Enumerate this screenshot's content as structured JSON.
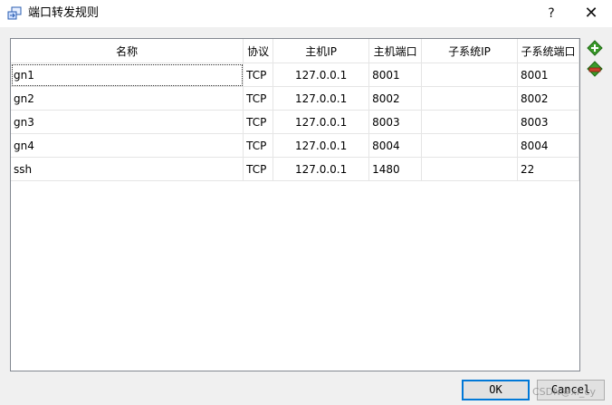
{
  "window": {
    "title": "端口转发规则",
    "help_label": "?",
    "close_label": "✕"
  },
  "table": {
    "columns": [
      "名称",
      "协议",
      "主机IP",
      "主机端口",
      "子系统IP",
      "子系统端口"
    ],
    "rows": [
      {
        "name": "gn1",
        "protocol": "TCP",
        "host_ip": "127.0.0.1",
        "host_port": "8001",
        "guest_ip": "",
        "guest_port": "8001"
      },
      {
        "name": "gn2",
        "protocol": "TCP",
        "host_ip": "127.0.0.1",
        "host_port": "8002",
        "guest_ip": "",
        "guest_port": "8002"
      },
      {
        "name": "gn3",
        "protocol": "TCP",
        "host_ip": "127.0.0.1",
        "host_port": "8003",
        "guest_ip": "",
        "guest_port": "8003"
      },
      {
        "name": "gn4",
        "protocol": "TCP",
        "host_ip": "127.0.0.1",
        "host_port": "8004",
        "guest_ip": "",
        "guest_port": "8004"
      },
      {
        "name": "ssh",
        "protocol": "TCP",
        "host_ip": "127.0.0.1",
        "host_port": "1480",
        "guest_ip": "",
        "guest_port": "22"
      }
    ]
  },
  "side_buttons": {
    "add_icon": "add-rule-icon",
    "remove_icon": "remove-rule-icon"
  },
  "buttons": {
    "ok": "OK",
    "cancel": "Cancel"
  },
  "watermark": "CSDN@xl_cy",
  "colors": {
    "add_green": "#3a9a2a",
    "remove_red": "#c8412c",
    "focus_blue": "#0078d7"
  }
}
